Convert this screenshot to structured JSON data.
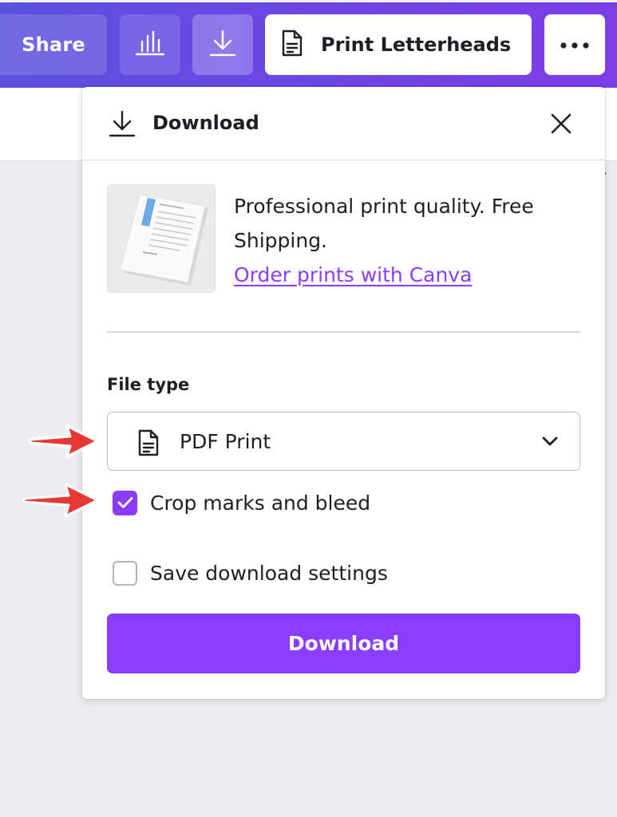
{
  "toolbar": {
    "share_label": "Share",
    "insights_icon": "bar-chart-icon",
    "download_icon": "download-icon",
    "print_label": "Print Letterheads",
    "print_icon": "document-icon",
    "more_icon": "more-dots-icon"
  },
  "panel": {
    "title": "Download",
    "close_icon": "close-icon",
    "promo": {
      "text": "Professional print quality. Free Shipping.",
      "link": "Order prints with Canva"
    },
    "file_type": {
      "label": "File type",
      "selected": "PDF Print",
      "icon": "document-icon"
    },
    "options": {
      "crop_marks": {
        "label": "Crop marks and bleed",
        "checked": true
      },
      "save_settings": {
        "label": "Save download settings",
        "checked": false
      }
    },
    "download_button": "Download"
  },
  "colors": {
    "accent": "#8b3dff",
    "topbar_start": "#5b52dd",
    "topbar_end": "#7d3ee6",
    "annotation_arrow": "#e53935"
  }
}
